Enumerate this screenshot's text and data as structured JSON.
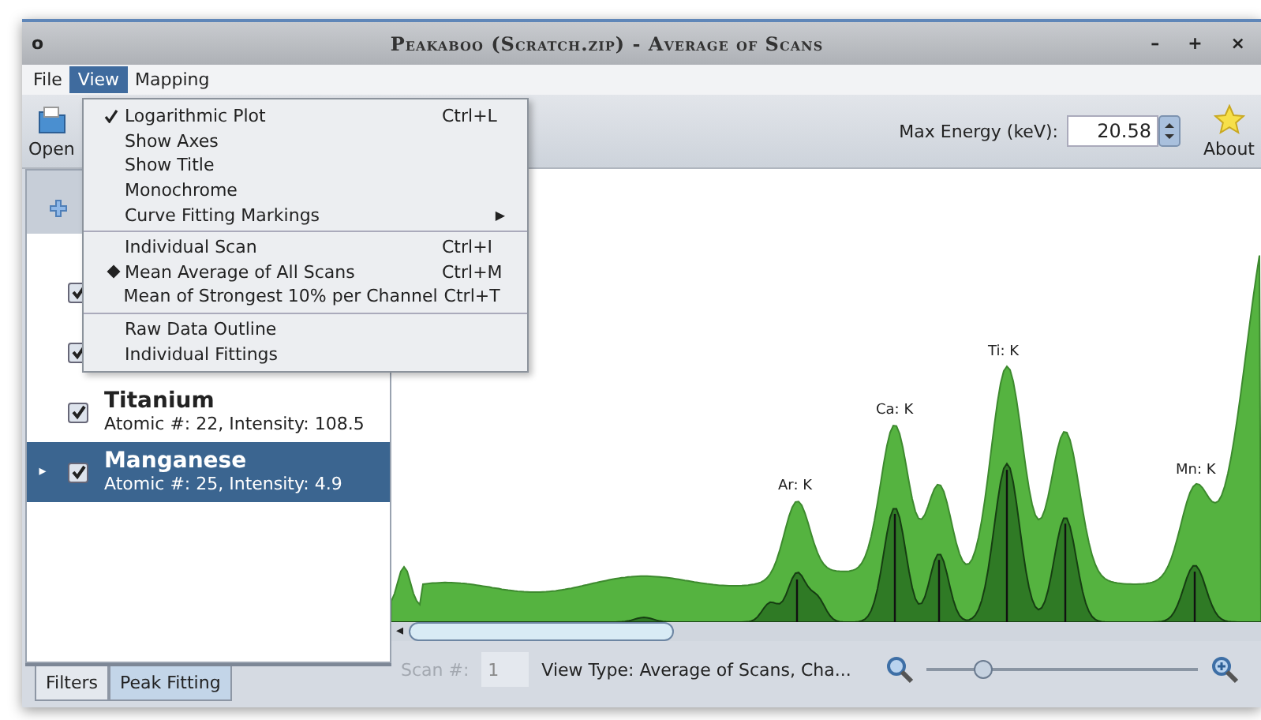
{
  "window": {
    "title": "Peakaboo (Scratch.zip) - Average of Scans",
    "menu_glyph": "o",
    "controls": [
      "–",
      "+",
      "×"
    ]
  },
  "menubar": [
    {
      "label": "File",
      "selected": false
    },
    {
      "label": "View",
      "selected": true
    },
    {
      "label": "Mapping",
      "selected": false
    }
  ],
  "toolbar": {
    "open": "Open",
    "max_energy_label": "Max Energy (keV):",
    "max_energy": "20.58",
    "about": "About"
  },
  "view_menu": [
    {
      "kind": "check",
      "label": "Logarithmic Plot",
      "checked": true,
      "shortcut": "Ctrl+L"
    },
    {
      "kind": "check",
      "label": "Show Axes",
      "checked": false
    },
    {
      "kind": "check",
      "label": "Show Title",
      "checked": false
    },
    {
      "kind": "check",
      "label": "Monochrome",
      "checked": false
    },
    {
      "kind": "submenu",
      "label": "Curve Fitting Markings",
      "arrow": "▶"
    },
    {
      "kind": "separator"
    },
    {
      "kind": "radio",
      "label": "Individual Scan",
      "selected": false,
      "shortcut": "Ctrl+I"
    },
    {
      "kind": "radio",
      "label": "Mean Average of All Scans",
      "selected": true,
      "shortcut": "Ctrl+M"
    },
    {
      "kind": "radio",
      "label": "Mean of Strongest 10% per Channel",
      "selected": false,
      "shortcut": "Ctrl+T"
    },
    {
      "kind": "separator"
    },
    {
      "kind": "check",
      "label": "Raw Data Outline",
      "checked": false
    },
    {
      "kind": "check",
      "label": "Individual Fittings",
      "checked": false
    }
  ],
  "elements": [
    {
      "checked": true,
      "selected": false
    },
    {
      "checked": true,
      "selected": false
    },
    {
      "name": "Titanium",
      "detail": "Atomic #: 22, Intensity: 108.5",
      "checked": true,
      "selected": false
    },
    {
      "name": "Manganese",
      "detail": "Atomic #: 25, Intensity: 4.9",
      "checked": true,
      "selected": true,
      "expander": "▸"
    }
  ],
  "tabs": [
    {
      "label": "Filters",
      "selected": false
    },
    {
      "label": "Peak Fitting",
      "selected": true
    }
  ],
  "peak_labels": [
    "Ar: K",
    "Ca: K",
    "Ti: K",
    "Mn: K"
  ],
  "scroll_arrow": "◂",
  "status": {
    "scan_label": "Scan #:",
    "scan_value": "1",
    "view_type": "View Type: Average of Scans,  Cha...",
    "zoom": {
      "level": 0.21
    }
  }
}
